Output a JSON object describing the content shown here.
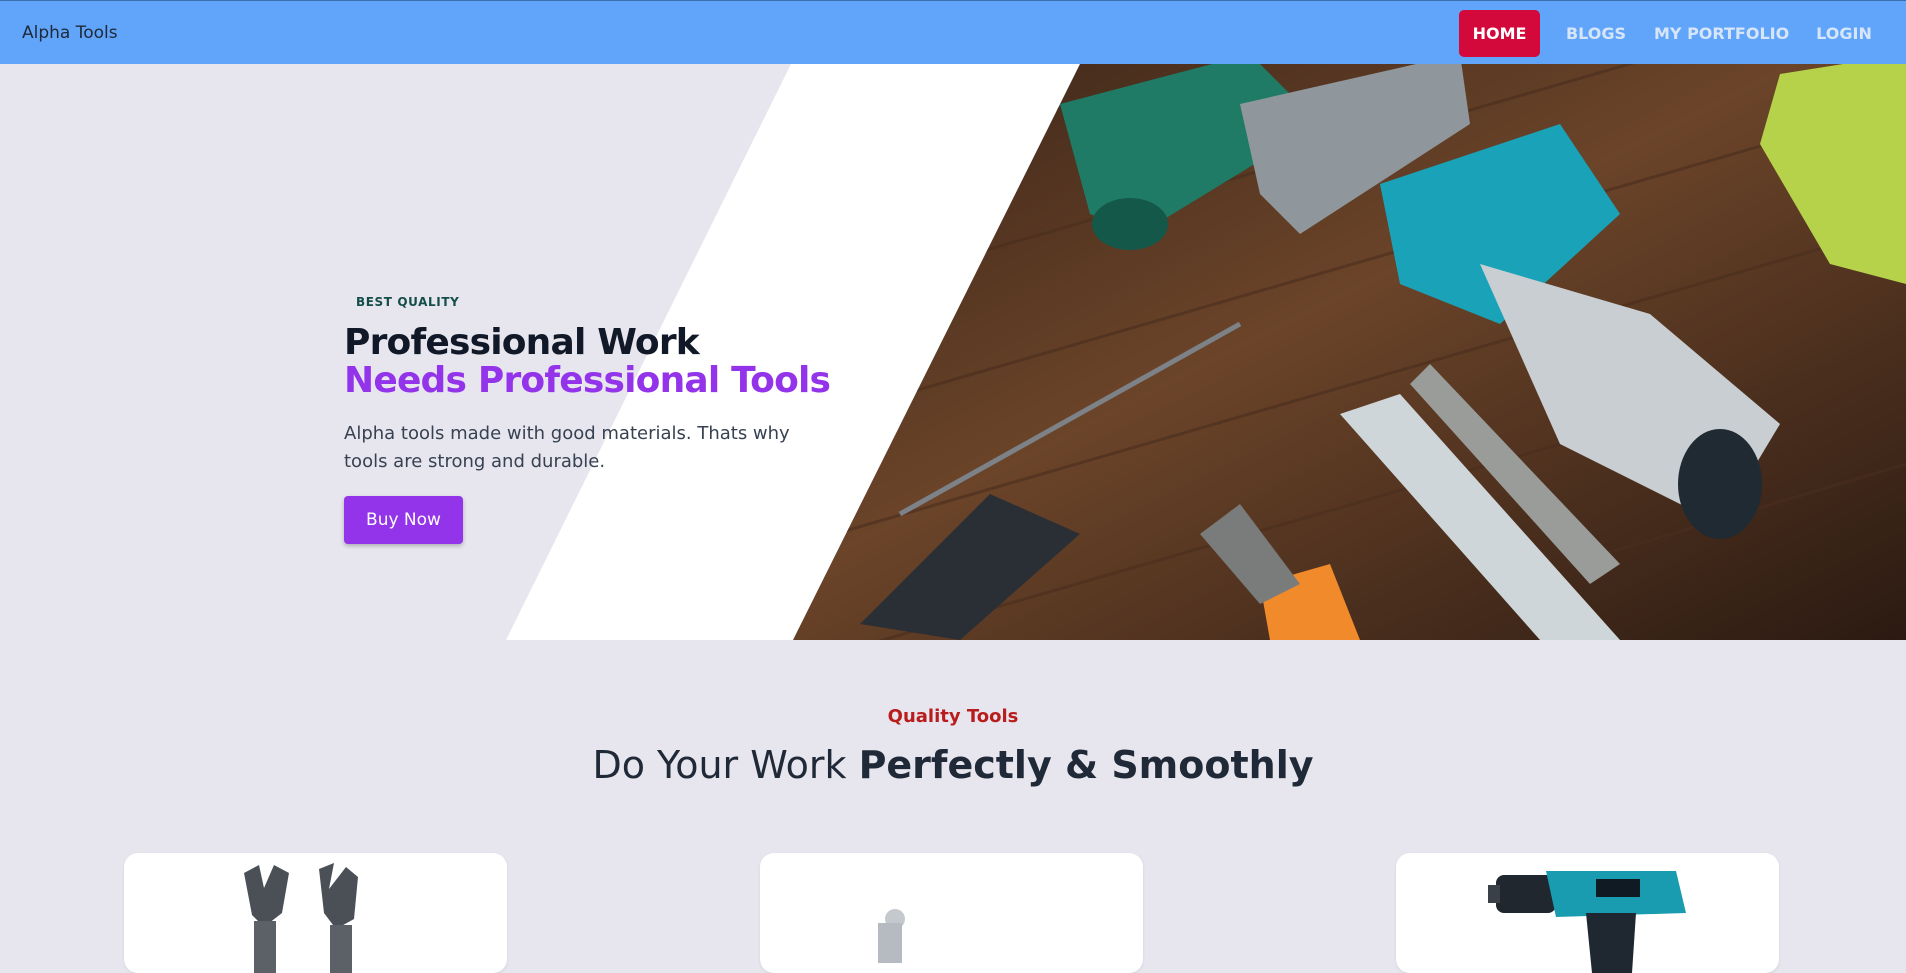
{
  "navbar": {
    "brand": "Alpha Tools",
    "links": [
      {
        "label": "HOME",
        "active": true
      },
      {
        "label": "BLOGS",
        "active": false
      },
      {
        "label": "MY PORTFOLIO",
        "active": false
      },
      {
        "label": "LOGIN",
        "active": false
      }
    ]
  },
  "hero": {
    "eyebrow": "BEST QUALITY",
    "headline_line1": "Professional Work",
    "headline_line2": "Needs Professional Tools",
    "description": "Alpha tools made with good materials. Thats why tools are strong and durable.",
    "cta_label": "Buy Now",
    "image_subject": "power-tools-on-wooden-table"
  },
  "features": {
    "eyebrow": "Quality Tools",
    "title_regular": "Do Your Work ",
    "title_bold": "Perfectly & Smoothly",
    "cards": [
      {
        "image_subject": "adjustable-wrenches"
      },
      {
        "image_subject": "tool-part"
      },
      {
        "image_subject": "cordless-drill"
      }
    ]
  },
  "colors": {
    "navbar": "#60a5fa",
    "active_link": "#d4093b",
    "accent_purple": "#9333ea",
    "eyebrow_red": "#b91c1c",
    "page_background": "#e7e6ee"
  }
}
